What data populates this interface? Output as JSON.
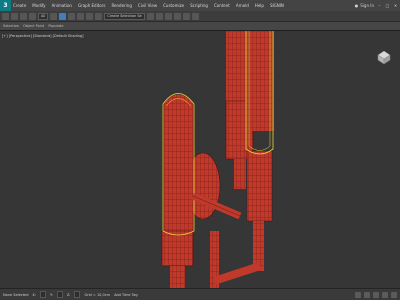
{
  "menubar": {
    "app_icon": "3ds-max-logo",
    "items": [
      "Create",
      "Modify",
      "Animation",
      "Graph Editors",
      "Rendering",
      "Civil View",
      "Customize",
      "Scripting",
      "Content",
      "Arnold",
      "Help",
      "SIGNIN"
    ],
    "sign_in": "Sign In",
    "window_controls": [
      "minimize",
      "maximize",
      "close"
    ]
  },
  "toolbar": {
    "selection_filter": "All",
    "named_selection": "Create Selection Se",
    "icons": [
      "undo-icon",
      "redo-icon",
      "link-icon",
      "unlink-icon",
      "select-icon",
      "move-icon",
      "rotate-icon",
      "scale-icon",
      "snap-icon",
      "mirror-icon",
      "align-icon",
      "render-icon"
    ]
  },
  "ribbon": {
    "tabs": [
      "Selection",
      "Object Paint",
      "Populate"
    ]
  },
  "viewport": {
    "label": "[+] [Perspective] [Standard] [Default Shading]",
    "object_color": "#c0392b",
    "wire_color": "#4a1010",
    "selection_color": "#e8d83a"
  },
  "statusbar": {
    "selected": "None Selected",
    "x": "X:",
    "y": "Y:",
    "z": "Z:",
    "grid": "Grid = 10,0cm",
    "auto_key": "Add Time Tag",
    "frame": "0"
  }
}
